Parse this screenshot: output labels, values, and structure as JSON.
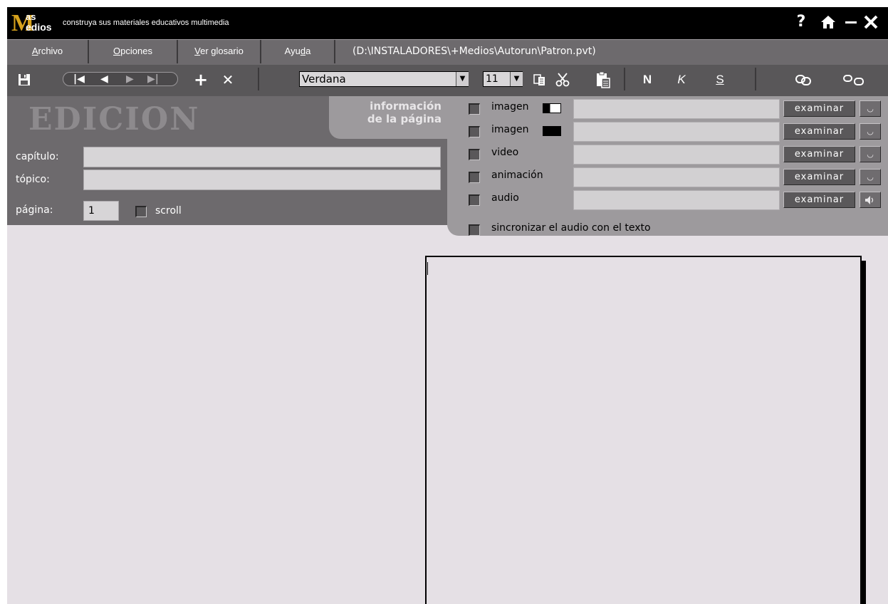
{
  "app": {
    "logo_line1": "as",
    "logo_m": "M",
    "logo_line2": "edios",
    "tagline": "construya sus materiales educativos multimedia",
    "controls": {
      "help": "?",
      "home": "⌂",
      "minimize": "–",
      "close": "✕"
    }
  },
  "menu": {
    "items": [
      {
        "underline": "A",
        "rest": "rchivo"
      },
      {
        "underline": "O",
        "rest": "pciones"
      },
      {
        "underline": "V",
        "rest": "er glosario"
      },
      {
        "pre": "Ayu",
        "underline": "d",
        "rest": "a"
      }
    ],
    "file_path": "(D:\\INSTALADORES\\+Medios\\Autorun\\Patron.pvt)"
  },
  "toolbar": {
    "font": "Verdana",
    "font_size": "11",
    "bold": "N",
    "italic": "K",
    "underline": "S",
    "add": "+",
    "delete": "✕",
    "nav": {
      "first": "|◀",
      "prev": "◀",
      "next": "▶",
      "last": "▶|"
    }
  },
  "edit": {
    "title": "EDICION",
    "chapter_label": "capítulo:",
    "topic_label": "tópico:",
    "page_label": "página:",
    "page_value": "1",
    "scroll_label": "scroll"
  },
  "info_tab": {
    "line1": "información",
    "line2": "de la página"
  },
  "media": {
    "rows": [
      {
        "label": "imagen",
        "button": "examinar"
      },
      {
        "label": "imagen",
        "button": "examinar"
      },
      {
        "label": "video",
        "button": "examinar"
      },
      {
        "label": "animación",
        "button": "examinar"
      },
      {
        "label": "audio",
        "button": "examinar"
      }
    ],
    "sync_label": "sincronizar el audio con el texto",
    "colors": {
      "panel": "#9d9a9d",
      "button": "#5a585a"
    }
  }
}
